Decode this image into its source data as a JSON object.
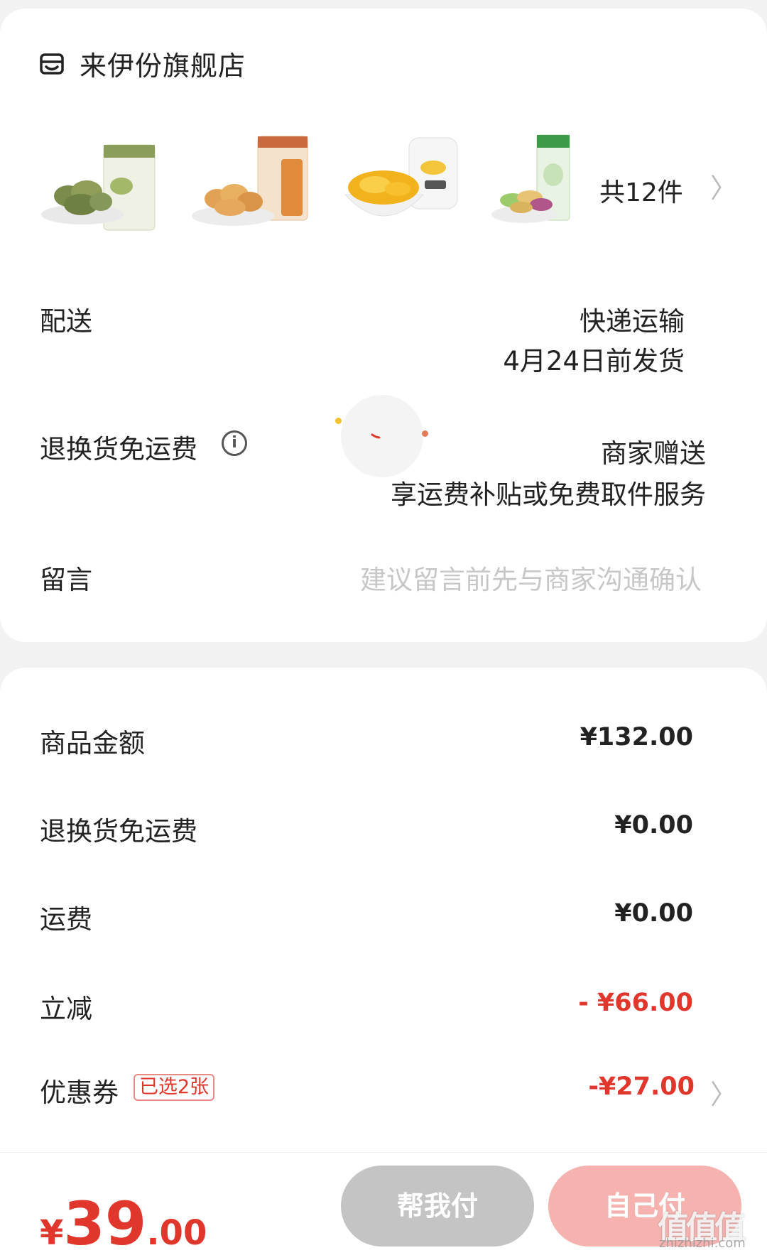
{
  "shop": {
    "name": "来伊份旗舰店",
    "icon": "shop-icon"
  },
  "products": {
    "count_label": "共12件",
    "items": [
      {
        "name": "olive-snack-product",
        "color": "#8a9d5a"
      },
      {
        "name": "peanut-snack-product",
        "color": "#e0a050"
      },
      {
        "name": "yellow-peach-product",
        "color": "#f2b21c"
      },
      {
        "name": "veggie-chips-product",
        "color": "#7cb86a"
      }
    ]
  },
  "delivery": {
    "label": "配送",
    "method": "快递运输",
    "ship_by": "4月24日前发货"
  },
  "return_freight": {
    "label": "退换货免运费",
    "value": "商家赠送",
    "desc": "享运费补贴或免费取件服务"
  },
  "message": {
    "label": "留言",
    "placeholder": "建议留言前先与商家沟通确认"
  },
  "summary": {
    "goods_amount": {
      "label": "商品金额",
      "value": "¥132.00"
    },
    "return_freight": {
      "label": "退换货免运费",
      "value": "¥0.00"
    },
    "shipping": {
      "label": "运费",
      "value": "¥0.00"
    },
    "instant_discount": {
      "label": "立减",
      "value": "- ¥66.00"
    },
    "coupon": {
      "label": "优惠券",
      "tag": "已选2张",
      "value": "-¥27.00"
    }
  },
  "footer": {
    "total_symbol": "¥",
    "total_int": "39",
    "total_dec": ".00",
    "help_pay_label": "帮我付",
    "self_pay_label": "自己付"
  },
  "watermark": {
    "main": "值值值",
    "sub": "zhizhizhi.com"
  },
  "colors": {
    "accent_red": "#e0362c",
    "button_gray": "#c4c4c4",
    "button_pink": "#f6b2ae"
  }
}
